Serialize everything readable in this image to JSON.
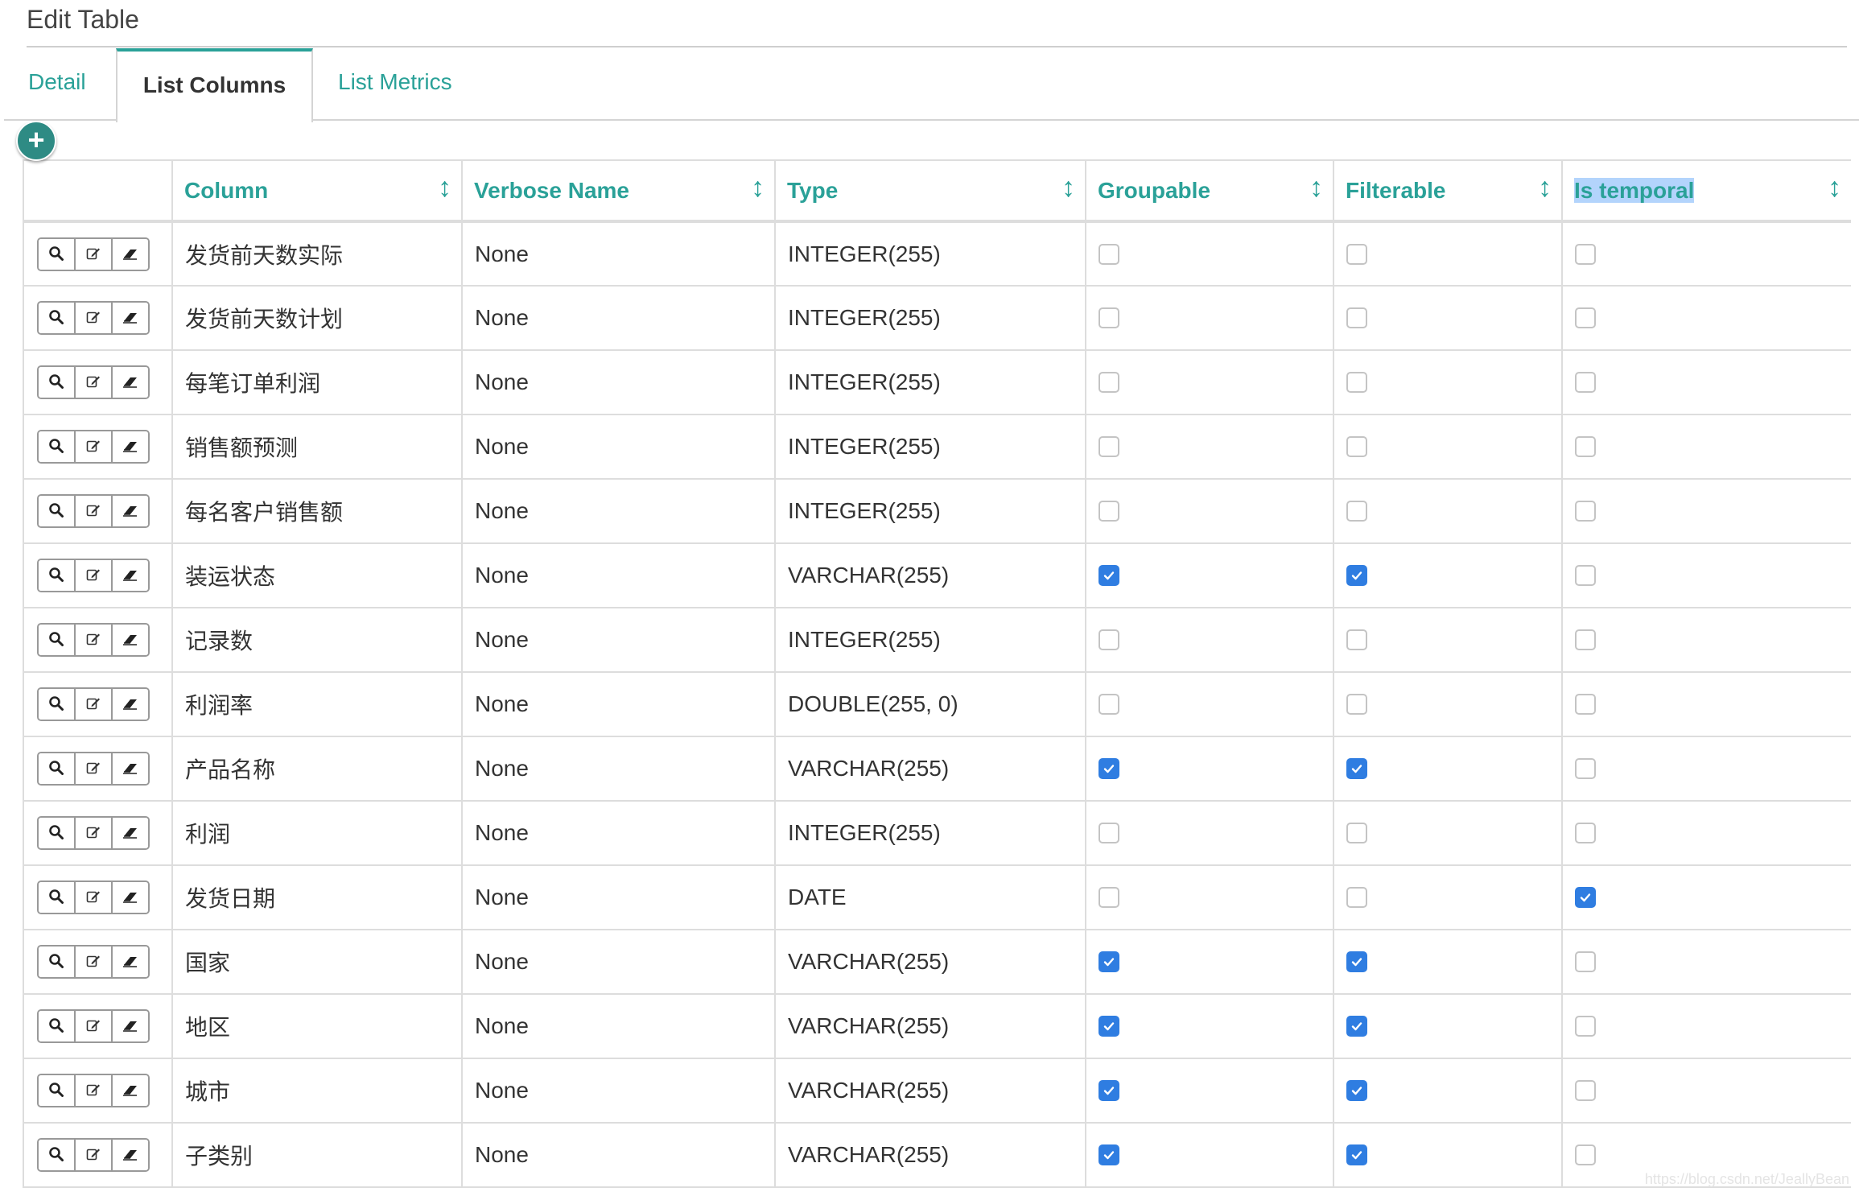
{
  "page": {
    "title": "Edit Table",
    "watermark": "https://blog.csdn.net/JeallyBean"
  },
  "tabs": [
    {
      "label": "Detail",
      "active": false
    },
    {
      "label": "List Columns",
      "active": true
    },
    {
      "label": "List Metrics",
      "active": false
    }
  ],
  "add_button": {
    "label": "+"
  },
  "table": {
    "headers": {
      "actions": "",
      "column": "Column",
      "verbose_name": "Verbose Name",
      "type": "Type",
      "groupable": "Groupable",
      "filterable": "Filterable",
      "is_temporal": "Is temporal"
    },
    "sort_icon": "↕",
    "rows": [
      {
        "column": "发货前天数实际",
        "verbose_name": "None",
        "type": "INTEGER(255)",
        "groupable": false,
        "filterable": false,
        "is_temporal": false
      },
      {
        "column": "发货前天数计划",
        "verbose_name": "None",
        "type": "INTEGER(255)",
        "groupable": false,
        "filterable": false,
        "is_temporal": false
      },
      {
        "column": "每笔订单利润",
        "verbose_name": "None",
        "type": "INTEGER(255)",
        "groupable": false,
        "filterable": false,
        "is_temporal": false
      },
      {
        "column": "销售额预测",
        "verbose_name": "None",
        "type": "INTEGER(255)",
        "groupable": false,
        "filterable": false,
        "is_temporal": false
      },
      {
        "column": "每名客户销售额",
        "verbose_name": "None",
        "type": "INTEGER(255)",
        "groupable": false,
        "filterable": false,
        "is_temporal": false
      },
      {
        "column": "装运状态",
        "verbose_name": "None",
        "type": "VARCHAR(255)",
        "groupable": true,
        "filterable": true,
        "is_temporal": false
      },
      {
        "column": "记录数",
        "verbose_name": "None",
        "type": "INTEGER(255)",
        "groupable": false,
        "filterable": false,
        "is_temporal": false
      },
      {
        "column": "利润率",
        "verbose_name": "None",
        "type": "DOUBLE(255, 0)",
        "groupable": false,
        "filterable": false,
        "is_temporal": false
      },
      {
        "column": "产品名称",
        "verbose_name": "None",
        "type": "VARCHAR(255)",
        "groupable": true,
        "filterable": true,
        "is_temporal": false
      },
      {
        "column": "利润",
        "verbose_name": "None",
        "type": "INTEGER(255)",
        "groupable": false,
        "filterable": false,
        "is_temporal": false
      },
      {
        "column": "发货日期",
        "verbose_name": "None",
        "type": "DATE",
        "groupable": false,
        "filterable": false,
        "is_temporal": true
      },
      {
        "column": "国家",
        "verbose_name": "None",
        "type": "VARCHAR(255)",
        "groupable": true,
        "filterable": true,
        "is_temporal": false
      },
      {
        "column": "地区",
        "verbose_name": "None",
        "type": "VARCHAR(255)",
        "groupable": true,
        "filterable": true,
        "is_temporal": false
      },
      {
        "column": "城市",
        "verbose_name": "None",
        "type": "VARCHAR(255)",
        "groupable": true,
        "filterable": true,
        "is_temporal": false
      },
      {
        "column": "子类别",
        "verbose_name": "None",
        "type": "VARCHAR(255)",
        "groupable": true,
        "filterable": true,
        "is_temporal": false
      }
    ]
  },
  "icons": {
    "show": "search-icon",
    "edit": "edit-icon",
    "delete": "eraser-icon",
    "sort": "sort-icon"
  },
  "colors": {
    "accent": "#2aa198",
    "checkbox_checked": "#2f7de1",
    "border": "#dddddd"
  }
}
